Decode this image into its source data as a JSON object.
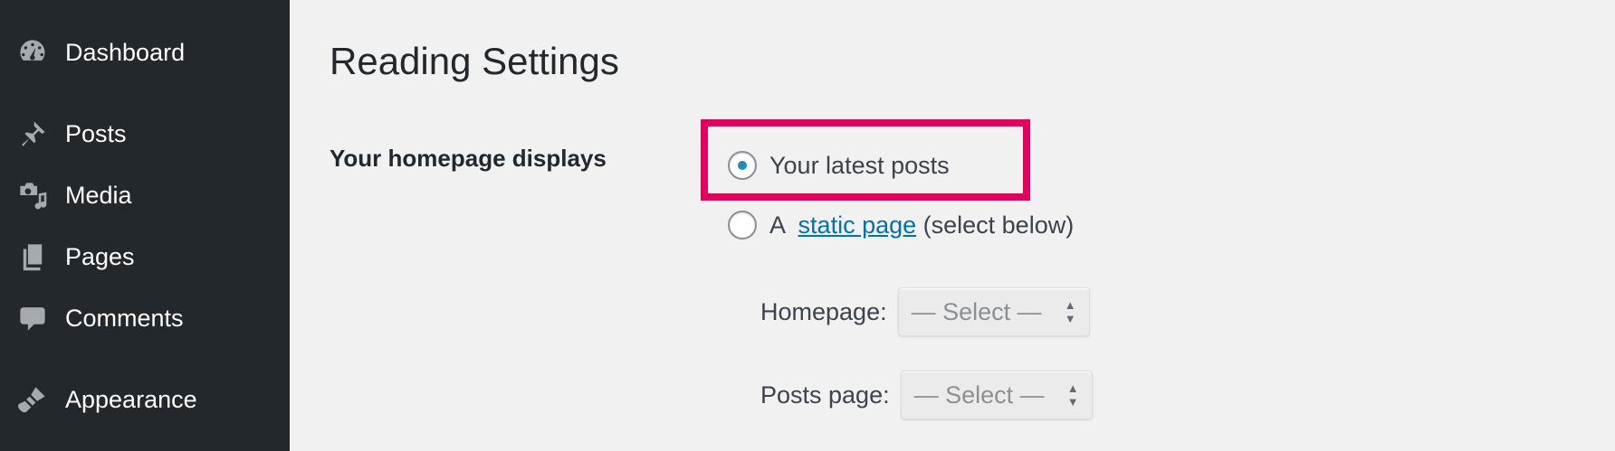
{
  "sidebar": {
    "items": [
      {
        "label": "Dashboard",
        "icon": "dashboard-icon"
      },
      {
        "label": "Posts",
        "icon": "pin-icon"
      },
      {
        "label": "Media",
        "icon": "media-icon"
      },
      {
        "label": "Pages",
        "icon": "pages-icon"
      },
      {
        "label": "Comments",
        "icon": "comment-icon"
      },
      {
        "label": "Appearance",
        "icon": "brush-icon"
      }
    ]
  },
  "main": {
    "title": "Reading Settings",
    "homepage_displays": {
      "label": "Your homepage displays",
      "options": [
        {
          "label": "Your latest posts",
          "selected": true
        },
        {
          "prefix": "A ",
          "link": "static page",
          "suffix": " (select below)",
          "selected": false
        }
      ]
    },
    "homepage_select": {
      "label": "Homepage:",
      "value": "— Select —"
    },
    "posts_page_select": {
      "label": "Posts page:",
      "value": "— Select —"
    }
  },
  "colors": {
    "sidebar_bg": "#23282d",
    "highlight_border": "#e5005f",
    "link": "#0073aa",
    "radio_dot": "#1e8cbe"
  }
}
